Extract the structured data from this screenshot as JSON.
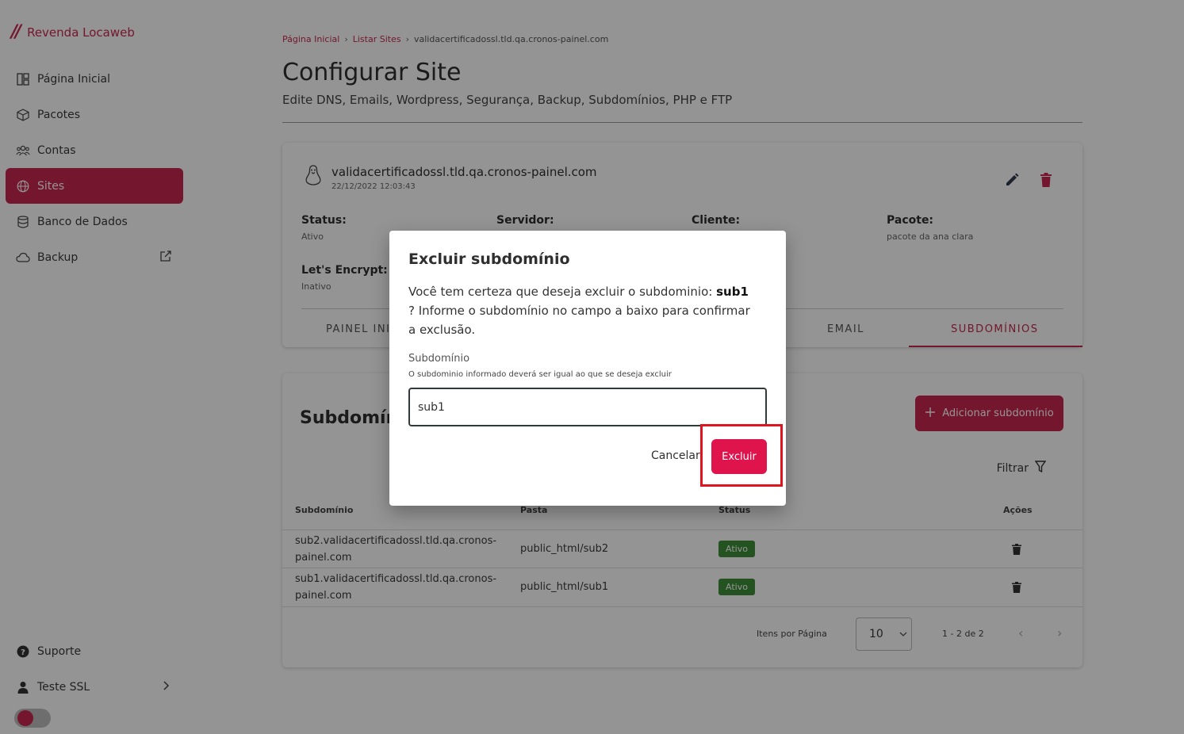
{
  "brand": {
    "name": "Revenda Locaweb"
  },
  "sidebar": {
    "items": [
      {
        "label": "Página Inicial",
        "icon": "dashboard-icon"
      },
      {
        "label": "Pacotes",
        "icon": "box-icon"
      },
      {
        "label": "Contas",
        "icon": "users-icon"
      },
      {
        "label": "Sites",
        "icon": "globe-icon"
      },
      {
        "label": "Banco de Dados",
        "icon": "database-icon"
      },
      {
        "label": "Backup",
        "icon": "cloud-icon"
      }
    ],
    "support_label": "Suporte",
    "user_label": "Teste SSL"
  },
  "breadcrumb": {
    "home": "Página Inicial",
    "list": "Listar Sites",
    "current": "validacertificadossl.tld.qa.cronos-painel.com"
  },
  "page": {
    "title": "Configurar Site",
    "subtitle": "Edite DNS, Emails, Wordpress, Segurança, Backup, Subdomínios, PHP e FTP"
  },
  "site": {
    "name": "validacertificadossl.tld.qa.cronos-painel.com",
    "date": "22/12/2022 12:03:43",
    "status_label": "Status:",
    "status_value": "Ativo",
    "server_label": "Servidor:",
    "client_label": "Cliente:",
    "package_label": "Pacote:",
    "package_value": "pacote da ana clara",
    "ssl_label": "Let's Encrypt:",
    "ssl_value": "Inativo"
  },
  "tabs": {
    "panel": "PAINEL INI",
    "email": "EMAIL",
    "subdomains": "SUBDOMÍNIOS"
  },
  "subdomains": {
    "title": "Subdomín",
    "add_label": "Adicionar subdomínio",
    "filter_label": "Filtrar",
    "columns": [
      "Subdomínio",
      "Pasta",
      "Status",
      "Ações"
    ],
    "rows": [
      {
        "subdomain": "sub2.validacertificadossl.tld.qa.cronos-painel.com",
        "folder": "public_html/sub2",
        "status": "Ativo"
      },
      {
        "subdomain": "sub1.validacertificadossl.tld.qa.cronos-painel.com",
        "folder": "public_html/sub1",
        "status": "Ativo"
      }
    ],
    "pager": {
      "items_label": "Itens por Página",
      "page_size": "10",
      "range": "1 - 2 de 2"
    }
  },
  "modal": {
    "title": "Excluir subdomínio",
    "text_before": "Você tem certeza que deseja excluir o subdominio: ",
    "target": "sub1",
    "text_after": " ? Informe o subdomínio no campo a baixo para confirmar a exclusão.",
    "field_label": "Subdomínio",
    "field_hint": "O subdominio informado deverá ser igual ao que se deseja excluir",
    "field_value": "sub1",
    "cancel_label": "Cancelar",
    "confirm_label": "Excluir"
  },
  "colors": {
    "brand": "#c8274f",
    "confirm": "#e0144d",
    "success": "#3f8f3a",
    "highlight": "#e0141e"
  }
}
